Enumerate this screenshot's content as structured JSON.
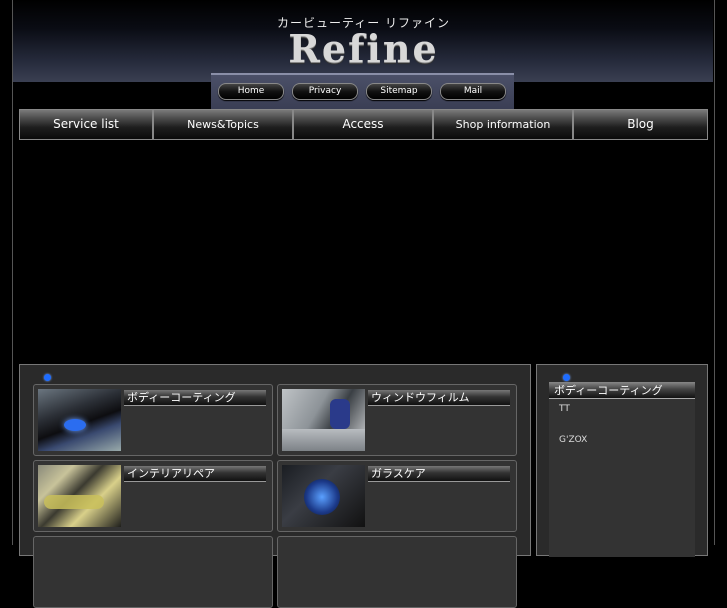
{
  "header": {
    "tagline": "カービューティー リファイン",
    "logo": "Refine"
  },
  "top_links": [
    {
      "label": "Home"
    },
    {
      "label": "Privacy"
    },
    {
      "label": "Sitemap"
    },
    {
      "label": "Mail"
    }
  ],
  "nav": [
    {
      "label": "Service list"
    },
    {
      "label": "News&Topics"
    },
    {
      "label": "Access"
    },
    {
      "label": "Shop information"
    },
    {
      "label": "Blog"
    }
  ],
  "services": [
    {
      "title": "ボディーコーティング",
      "thumb": "car-coating-photo"
    },
    {
      "title": "ウィンドウフィルム",
      "thumb": "window-film-photo"
    },
    {
      "title": "インテリアリペア",
      "thumb": "interior-repair-photo"
    },
    {
      "title": "ガラスケア",
      "thumb": "glass-care-photo"
    }
  ],
  "sidebar": {
    "title": "ボディーコーティング",
    "items": [
      {
        "label": "TT"
      },
      {
        "label": "G'ZOX"
      }
    ]
  },
  "colors": {
    "accent_dot": "#1e6cff",
    "background": "#000000",
    "panel": "#2a2a2a"
  }
}
